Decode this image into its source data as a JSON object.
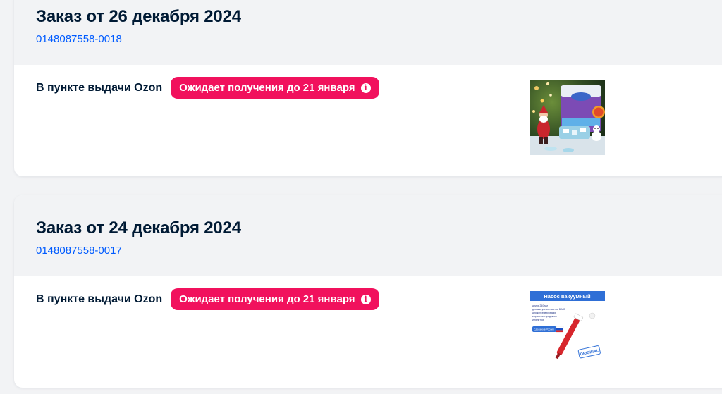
{
  "orders": [
    {
      "title": "Заказ от 26 декабря 2024",
      "number": "0148087558-0018",
      "pickup": "В пункте выдачи Ozon",
      "status": "Ожидает получения до 21 января",
      "product_image": "dishwasher-tablets-photo"
    },
    {
      "title": "Заказ от 24 декабря 2024",
      "number": "0148087558-0017",
      "pickup": "В пункте выдачи Ozon",
      "status": "Ожидает получения до 21 января",
      "product_image": "vacuum-pump-photo",
      "product_text": {
        "heading": "Насос вакуумный",
        "bullets": [
          "длина 240 мм",
          "для вакуумных пакетов BIMG",
          "для консервирования",
          "и хранения продуктов",
          "и напитков"
        ],
        "flag_label": "Сделано в России",
        "stamp": "ORIGINAL"
      }
    }
  ],
  "colors": {
    "link": "#005bff",
    "badge": "#f1115d",
    "header_bg": "#f2f3f5",
    "text": "#001a34"
  },
  "icons": {
    "info": "info-icon"
  }
}
